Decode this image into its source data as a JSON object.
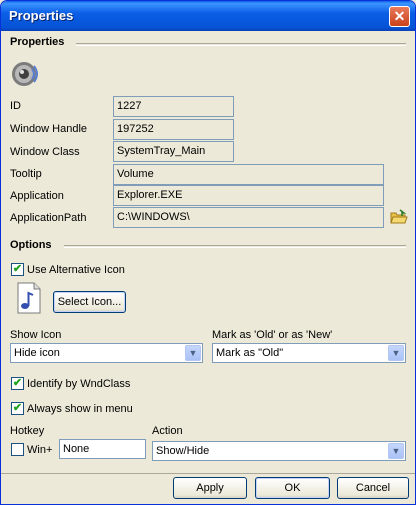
{
  "window": {
    "title": "Properties",
    "close_glyph": "✕"
  },
  "properties": {
    "header": "Properties",
    "id_label": "ID",
    "id_value": "1227",
    "handle_label": "Window Handle",
    "handle_value": "197252",
    "class_label": "Window Class",
    "class_value": "SystemTray_Main",
    "tooltip_label": "Tooltip",
    "tooltip_value": "Volume",
    "app_label": "Application",
    "app_value": "Explorer.EXE",
    "path_label": "ApplicationPath",
    "path_value": "C:\\WINDOWS\\"
  },
  "options": {
    "header": "Options",
    "use_alt_icon_label": "Use Alternative Icon",
    "select_icon_label": "Select Icon...",
    "show_icon_label": "Show Icon",
    "show_icon_value": "Hide icon",
    "mark_label": "Mark as 'Old' or as 'New'",
    "mark_value": "Mark as \"Old\"",
    "identify_label": "Identify by WndClass",
    "always_show_label": "Always show in menu",
    "hotkey_label": "Hotkey",
    "win_label": "Win+",
    "hotkey_value": "None",
    "action_label": "Action",
    "action_value": "Show/Hide",
    "check_glyph": "✔",
    "arrow_glyph": "▼"
  },
  "buttons": {
    "apply": "Apply",
    "ok": "OK",
    "cancel": "Cancel"
  }
}
